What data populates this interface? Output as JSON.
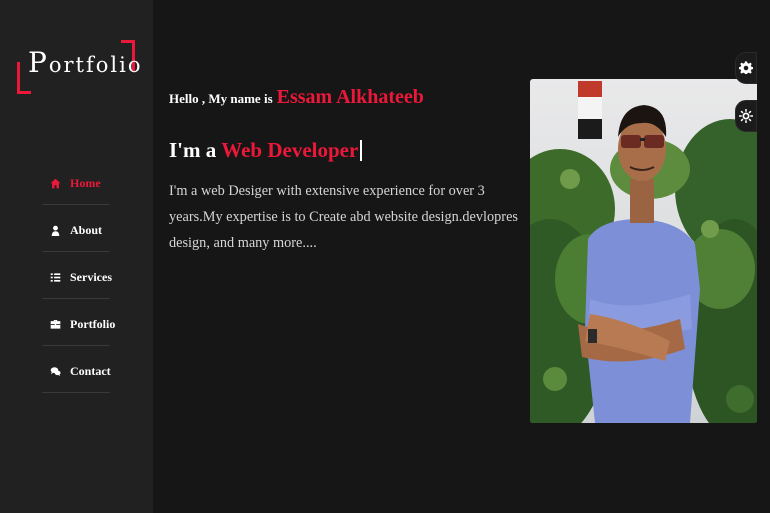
{
  "sidebar": {
    "logo": {
      "first_letter": "P",
      "rest": "ortfolio"
    },
    "items": [
      {
        "label": "Home",
        "icon": "home-icon",
        "active": true
      },
      {
        "label": "About",
        "icon": "user-icon"
      },
      {
        "label": "Services",
        "icon": "list-icon"
      },
      {
        "label": "Portfolio",
        "icon": "briefcase-icon"
      },
      {
        "label": "Contact",
        "icon": "comments-icon"
      }
    ]
  },
  "home": {
    "greeting": "Hello , My name is",
    "name": "Essam Alkhateeb",
    "role_prefix": "I'm a",
    "role": "Web Developer",
    "description": "I'm a web Desiger with extensive experience for over 3 years.My expertise is to Create abd website design.devlopres design, and many more...."
  },
  "tools": {
    "style_switcher_icon": "gear-icon",
    "day_night_icon": "sun-icon"
  },
  "colors": {
    "accent": "#ec1839",
    "sidebar_bg": "#212121",
    "page_bg": "#161616"
  }
}
